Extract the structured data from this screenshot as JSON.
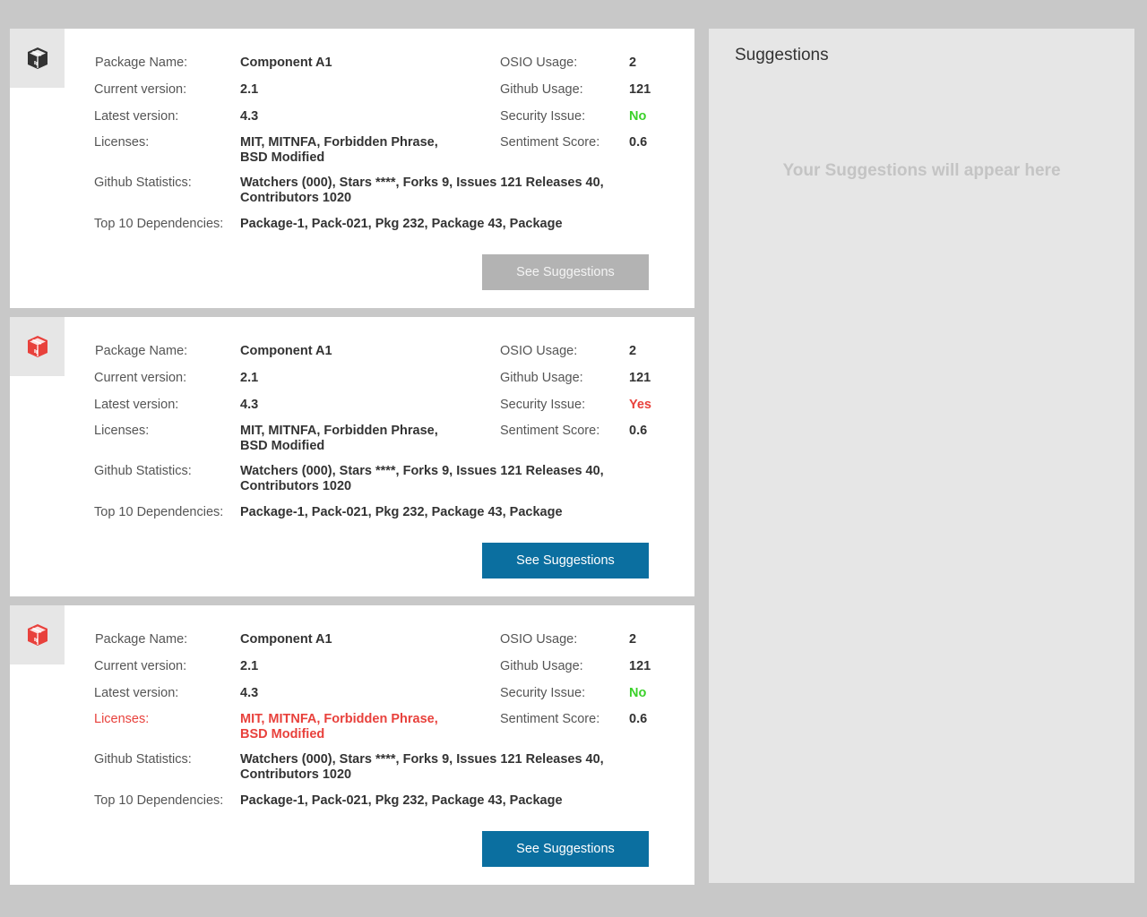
{
  "labels": {
    "package_name": "Package Name:",
    "current_version": "Current version:",
    "latest_version": "Latest  version:",
    "licenses": "Licenses:",
    "github_statistics": "Github Statistics:",
    "top_dependencies": "Top 10 Dependencies:",
    "osio_usage": "OSIO Usage:",
    "github_usage": "Github Usage:",
    "security_issue": "Security Issue:",
    "sentiment_score": "Sentiment Score:"
  },
  "colors": {
    "page_bg": "#c8c8c8",
    "card_bg": "#ffffff",
    "icon_bg": "#e6e6e6",
    "alert_red": "#e8413c",
    "ok_green": "#3bd12a",
    "button_blue": "#0b6fa0",
    "button_disabled": "#b3b3b3"
  },
  "cards": [
    {
      "icon": "package-box-icon",
      "icon_color": "#333333",
      "package_name": "Component A1",
      "current_version": "2.1",
      "latest_version": "4.3",
      "licenses_line1": "MIT, MITNFA, Forbidden Phrase,",
      "licenses_line2": "BSD Modified",
      "licenses_alert": false,
      "github_stats_line1": "Watchers (000), Stars ****, Forks 9, Issues 121 Releases 40,",
      "github_stats_line2": "Contributors 1020",
      "top_dependencies": "Package-1, Pack-021, Pkg 232, Package 43, Package",
      "osio_usage": "2",
      "github_usage": "121",
      "security_issue": "No",
      "sentiment_score": "0.6",
      "button_label": "See Suggestions",
      "button_state": "disabled"
    },
    {
      "icon": "package-box-icon",
      "icon_color": "#e8413c",
      "package_name": "Component A1",
      "current_version": "2.1",
      "latest_version": "4.3",
      "licenses_line1": "MIT, MITNFA, Forbidden Phrase,",
      "licenses_line2": "BSD Modified",
      "licenses_alert": false,
      "github_stats_line1": "Watchers (000), Stars ****, Forks 9, Issues 121 Releases 40,",
      "github_stats_line2": "Contributors 1020",
      "top_dependencies": "Package-1, Pack-021, Pkg 232, Package 43, Package",
      "osio_usage": "2",
      "github_usage": "121",
      "security_issue": "Yes",
      "sentiment_score": "0.6",
      "button_label": "See Suggestions",
      "button_state": "active"
    },
    {
      "icon": "package-box-icon",
      "icon_color": "#e8413c",
      "package_name": "Component A1",
      "current_version": "2.1",
      "latest_version": "4.3",
      "licenses_line1": "MIT, MITNFA, Forbidden Phrase,",
      "licenses_line2": "BSD Modified",
      "licenses_alert": true,
      "github_stats_line1": "Watchers (000), Stars ****, Forks 9, Issues 121 Releases 40,",
      "github_stats_line2": "Contributors 1020",
      "top_dependencies": "Package-1, Pack-021, Pkg 232, Package 43, Package",
      "osio_usage": "2",
      "github_usage": "121",
      "security_issue": "No",
      "sentiment_score": "0.6",
      "button_label": "See Suggestions",
      "button_state": "active"
    }
  ],
  "suggestions": {
    "title": "Suggestions",
    "empty_message": "Your Suggestions will appear here"
  }
}
